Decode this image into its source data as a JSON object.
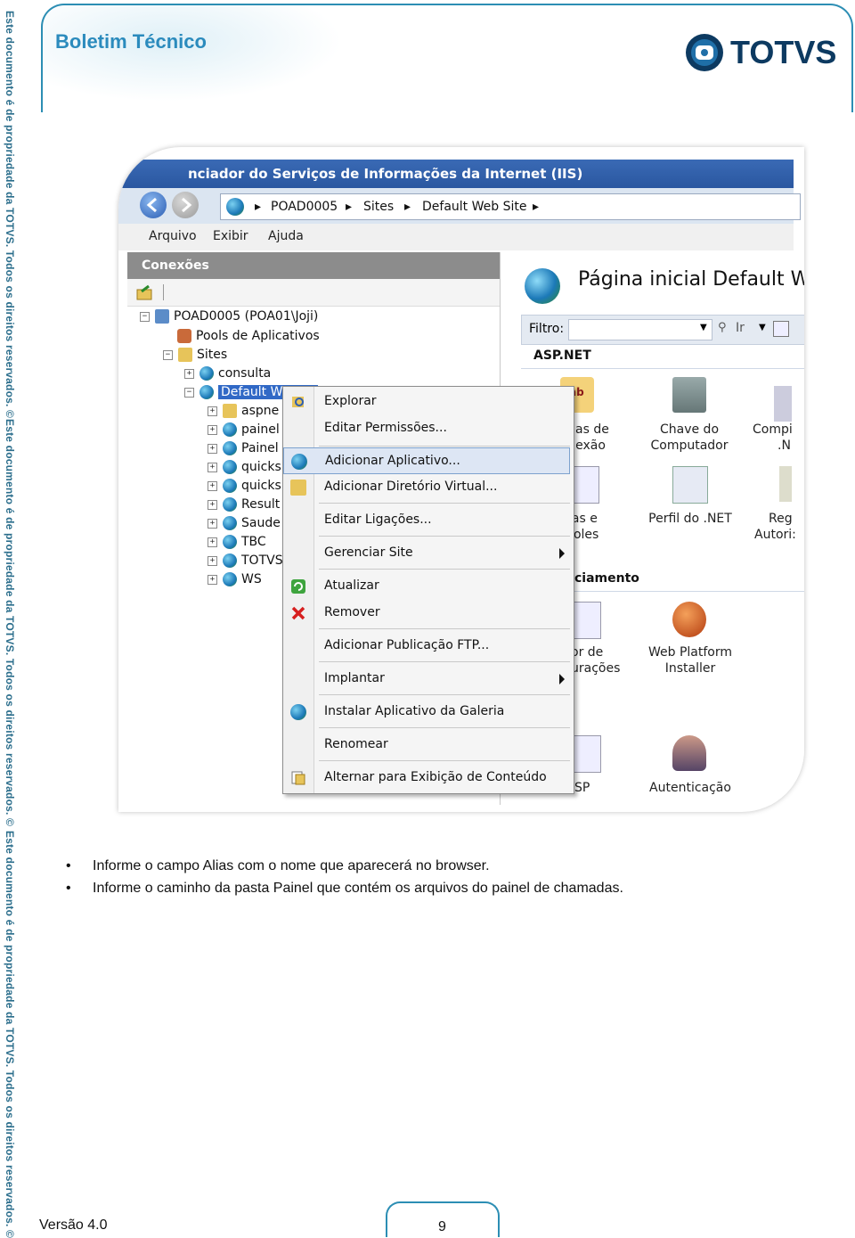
{
  "watermark": {
    "text": "Este documento é de propriedade da TOTVS. Todos os direitos reservados. ©"
  },
  "header": {
    "title": "Boletim Técnico",
    "logo_text": "TOTVS",
    "brand_color": "#2b8bbd"
  },
  "iis": {
    "window_title": "nciador do Serviços de Informações da Internet (IIS)",
    "breadcrumb": [
      "POAD0005",
      "Sites",
      "Default Web Site"
    ],
    "menu": [
      "Arquivo",
      "Exibir",
      "Ajuda"
    ],
    "connections_title": "Conexões",
    "tree": {
      "server": "POAD0005 (POA01\\Joji)",
      "app_pools": "Pools de Aplicativos",
      "sites": "Sites",
      "consulta": "consulta",
      "default_site": "Default W",
      "children": [
        "aspne",
        "painel",
        "Painel",
        "quicks",
        "quicks",
        "Result",
        "Saude",
        "TBC",
        "TOTVS",
        "WS"
      ]
    },
    "right": {
      "title": "Página inicial Default W",
      "filter_label": "Filtro:",
      "go_label": "Ir",
      "section": "ASP.NET",
      "features": [
        {
          "line1": "ias de",
          "line2": "exão"
        },
        {
          "line1": "Chave do",
          "line2": "Computador"
        },
        {
          "line1": "Compi",
          "line2": ".N"
        },
        {
          "line1": "nas e",
          "line2": "troles"
        },
        {
          "line1": "Perfil do .NET",
          "line2": ""
        },
        {
          "line1": "Reg",
          "line2": "Autori:"
        },
        {
          "line1": "or de",
          "line2": "urações"
        },
        {
          "line1": "Web Platform",
          "line2": "Installer"
        },
        {
          "line1": "SP",
          "line2": ""
        },
        {
          "line1": "Autenticação",
          "line2": ""
        }
      ],
      "section2": "ciamento",
      "icon_badge": "ab"
    },
    "context_menu": [
      {
        "label": "Explorar",
        "icon": "explore-icon"
      },
      {
        "label": "Editar Permissões...",
        "icon": ""
      },
      {
        "label": "Adicionar Aplicativo...",
        "icon": "add-application-icon"
      },
      {
        "label": "Adicionar Diretório Virtual...",
        "icon": "add-virtual-directory-icon"
      },
      {
        "label": "Editar Ligações...",
        "icon": ""
      },
      {
        "label": "Gerenciar Site",
        "icon": ""
      },
      {
        "label": "Atualizar",
        "icon": "refresh-icon"
      },
      {
        "label": "Remover",
        "icon": "remove-icon"
      },
      {
        "label": "Adicionar Publicação FTP...",
        "icon": ""
      },
      {
        "label": "Implantar",
        "icon": ""
      },
      {
        "label": "Instalar Aplicativo da Galeria",
        "icon": "gallery-icon"
      },
      {
        "label": "Renomear",
        "icon": ""
      },
      {
        "label": "Alternar para Exibição de Conteúdo",
        "icon": "content-view-icon"
      }
    ]
  },
  "bullets": [
    "Informe o campo Alias com o nome que aparecerá no browser.",
    "Informe o caminho da pasta Painel que contém os arquivos do painel de chamadas."
  ],
  "footer": {
    "version": "Versão 4.0",
    "page": "9"
  }
}
